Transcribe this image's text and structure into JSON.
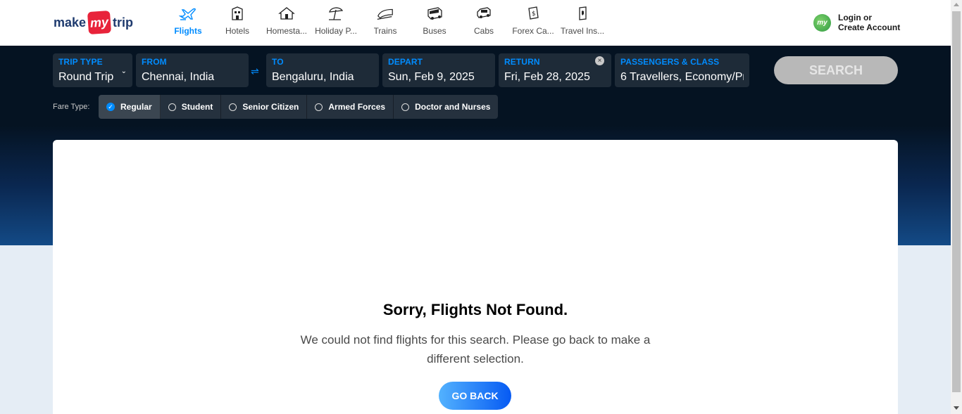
{
  "header": {
    "logo": {
      "pre": "make",
      "my": "my",
      "post": "trip"
    },
    "nav": [
      {
        "label": "Flights",
        "icon": "flight-icon",
        "active": true
      },
      {
        "label": "Hotels",
        "icon": "hotel-icon"
      },
      {
        "label": "Homesta...",
        "icon": "homestay-icon"
      },
      {
        "label": "Holiday P...",
        "icon": "holiday-package-icon"
      },
      {
        "label": "Trains",
        "icon": "train-icon"
      },
      {
        "label": "Buses",
        "icon": "bus-icon"
      },
      {
        "label": "Cabs",
        "icon": "cab-icon"
      },
      {
        "label": "Forex Ca...",
        "icon": "forex-card-icon"
      },
      {
        "label": "Travel Ins...",
        "icon": "travel-insurance-icon"
      }
    ],
    "login": {
      "avatar": "my",
      "line1": "Login or",
      "line2": "Create Account"
    }
  },
  "search": {
    "trip_type": {
      "label": "TRIP TYPE",
      "value": "Round Trip"
    },
    "from": {
      "label": "FROM",
      "value": "Chennai, India"
    },
    "to": {
      "label": "TO",
      "value": "Bengaluru, India"
    },
    "depart": {
      "label": "DEPART",
      "value": "Sun, Feb 9, 2025"
    },
    "return": {
      "label": "RETURN",
      "value": "Fri, Feb 28, 2025"
    },
    "passengers": {
      "label": "PASSENGERS & CLASS",
      "value": "6 Travellers, Economy/Pr"
    },
    "button": "SEARCH"
  },
  "fare": {
    "label": "Fare Type:",
    "options": [
      "Regular",
      "Student",
      "Senior Citizen",
      "Armed Forces",
      "Doctor and Nurses"
    ],
    "selected": "Regular"
  },
  "result": {
    "title": "Sorry, Flights Not Found.",
    "message": "We could not find flights for this search. Please go back to make a different selection.",
    "button": "GO BACK"
  },
  "colors": {
    "accent": "#008cff",
    "dark": "#051322",
    "brand_red": "#e8233a"
  }
}
